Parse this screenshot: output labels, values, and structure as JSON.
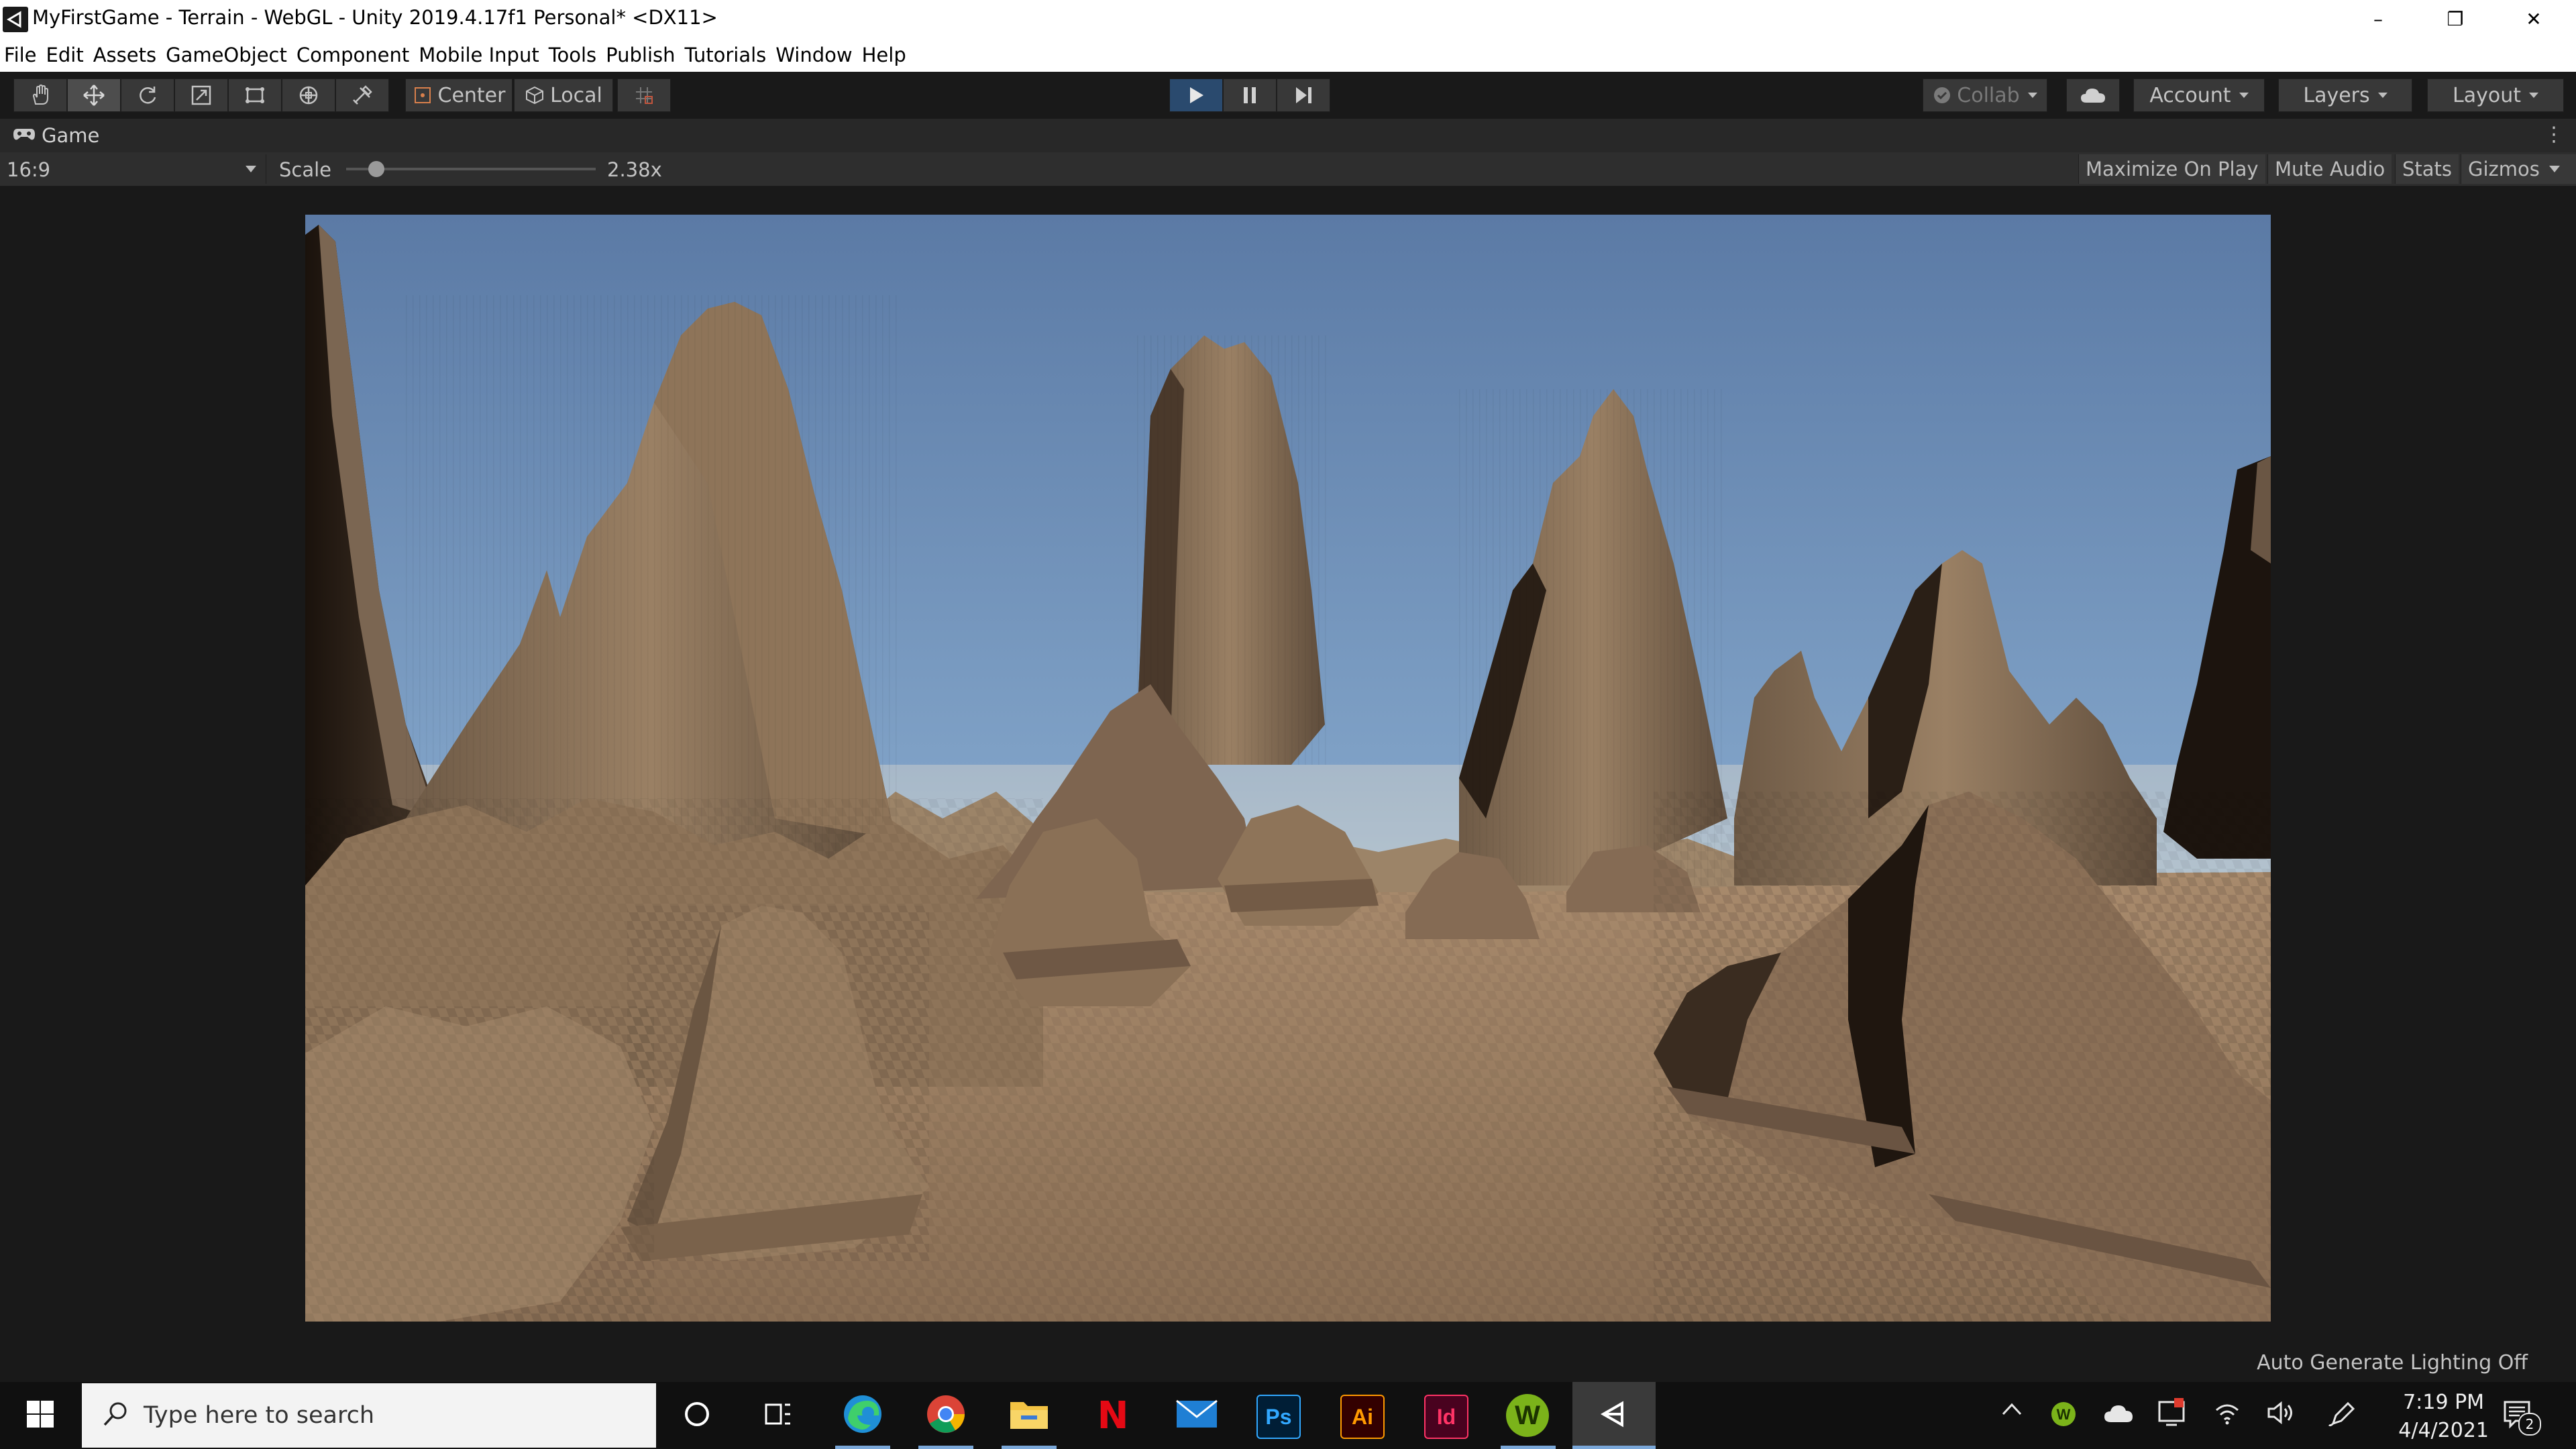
{
  "window": {
    "title": "MyFirstGame - Terrain - WebGL - Unity 2019.4.17f1 Personal* <DX11>",
    "minimize_glyph": "–",
    "restore_glyph": "❐",
    "close_glyph": "✕"
  },
  "menu": [
    "File",
    "Edit",
    "Assets",
    "GameObject",
    "Component",
    "Mobile Input",
    "Tools",
    "Publish",
    "Tutorials",
    "Window",
    "Help"
  ],
  "toolbar": {
    "tools": [
      "hand-icon",
      "move-icon",
      "rotate-icon",
      "scale-icon",
      "rect-icon",
      "transform-icon",
      "custom-tool-icon"
    ],
    "active_tool": "move-icon",
    "pivot_label": "Center",
    "space_label": "Local",
    "collab_label": "Collab",
    "account_label": "Account",
    "layers_label": "Layers",
    "layout_label": "Layout",
    "play_accent": "#2a4a6e"
  },
  "game_view": {
    "tab_label": "Game",
    "aspect_label": "16:9",
    "scale_label": "Scale",
    "scale_value": "2.38x",
    "scale_slider_fraction": 0.12,
    "maximize_label": "Maximize On Play",
    "mute_label": "Mute Audio",
    "stats_label": "Stats",
    "gizmos_label": "Gizmos"
  },
  "status": {
    "lighting": "Auto Generate Lighting Off"
  },
  "taskbar": {
    "search_placeholder": "Type here to search",
    "apps": [
      "cortana",
      "task-view",
      "edge",
      "chrome",
      "file-explorer",
      "netflix",
      "mail",
      "photoshop",
      "illustrator",
      "indesign",
      "w-app",
      "unity"
    ],
    "ps_label": "Ps",
    "ai_label": "Ai",
    "id_label": "Id",
    "netflix_label": "N",
    "w_label": "W",
    "time": "7:19 PM",
    "date": "4/4/2021",
    "notification_count": "2"
  }
}
